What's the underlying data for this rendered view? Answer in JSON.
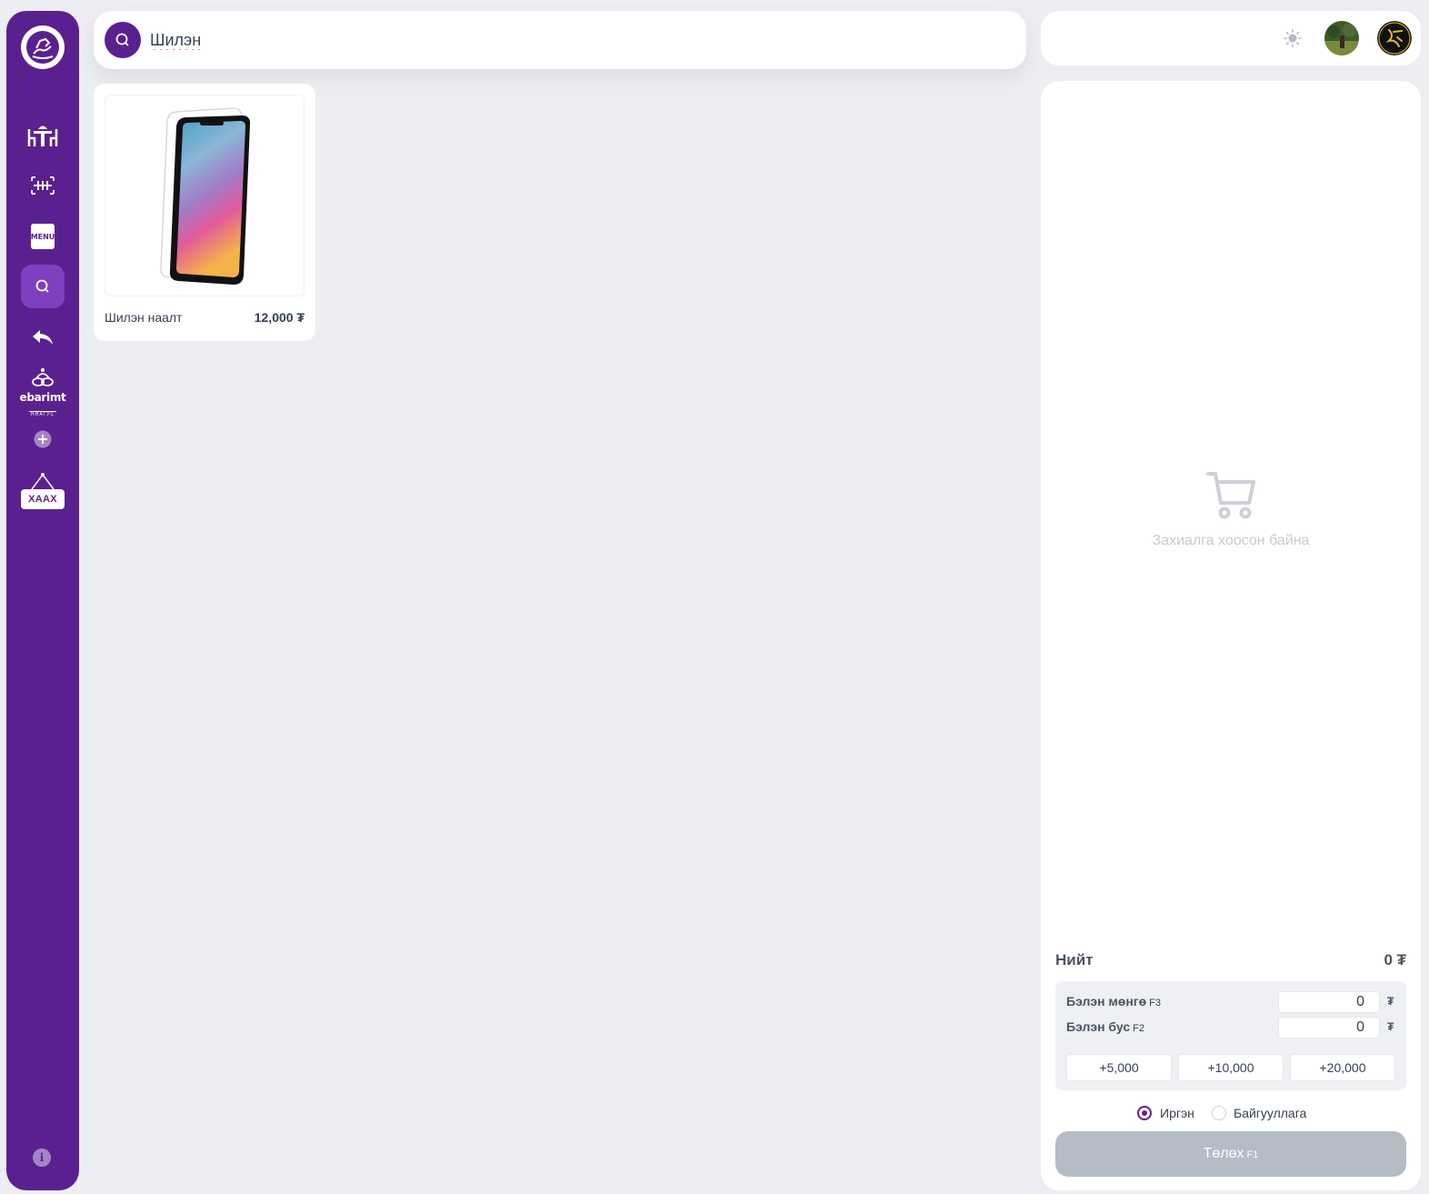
{
  "sidebar": {
    "items": [
      {
        "name": "tables",
        "icon": "dining-table-icon"
      },
      {
        "name": "barcode",
        "icon": "barcode-icon"
      },
      {
        "name": "menu",
        "icon": "menu-book-icon",
        "text": "MENU"
      },
      {
        "name": "search",
        "icon": "search-icon",
        "active": true
      },
      {
        "name": "return",
        "icon": "reply-icon"
      },
      {
        "name": "ebarimt",
        "icon": "ebarimt-logo-icon",
        "text": "ebarimt",
        "subtext": "НӨАТУС"
      },
      {
        "name": "add",
        "icon": "plus-circle-icon"
      },
      {
        "name": "close",
        "icon": "close-sign-icon",
        "text": "ХААХ"
      }
    ],
    "info_label": "i"
  },
  "search": {
    "value": "Шилэн"
  },
  "products": [
    {
      "name": "Шилэн наалт",
      "price": "12,000 ₮"
    }
  ],
  "header": {
    "theme_icon": "sun-icon",
    "avatars": [
      "user-avatar",
      "brand-avatar"
    ]
  },
  "order": {
    "empty_text": "Захиалга хоосон байна",
    "total_label": "Нийт",
    "total_value": "0 ₮",
    "cash_label": "Бэлэн мөнгө",
    "cash_key": "F3",
    "cash_value": "0",
    "noncash_label": "Бэлэн бус",
    "noncash_key": "F2",
    "noncash_value": "0",
    "currency": "₮",
    "quick_amounts": [
      "+5,000",
      "+10,000",
      "+20,000"
    ],
    "customer_types": [
      "Иргэн",
      "Байгууллага"
    ],
    "selected_customer_type": "Иргэн",
    "pay_label": "Төлөх",
    "pay_key": "F1"
  },
  "colors": {
    "primary": "#5b2090",
    "background": "#eceef1",
    "pay_button_disabled": "#b5bcc5"
  }
}
